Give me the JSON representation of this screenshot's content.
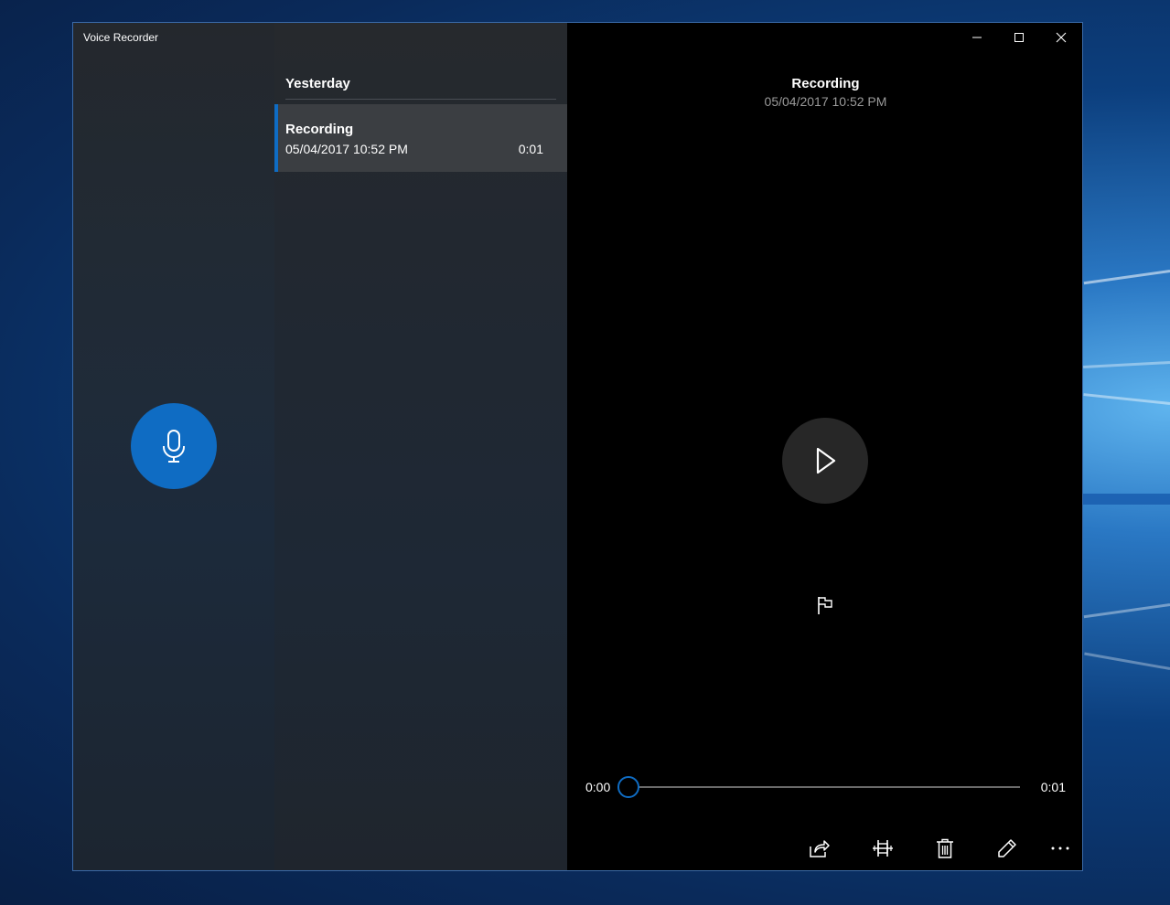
{
  "window": {
    "app_title": "Voice Recorder",
    "controls": {
      "minimize": "minimize-icon",
      "maximize": "maximize-icon",
      "close": "close-icon"
    }
  },
  "colors": {
    "accent": "#0f6cc3",
    "selected_item": "#3b3e42",
    "detail_bg": "#000000"
  },
  "record": {
    "icon": "microphone-icon"
  },
  "list": {
    "group_header": "Yesterday",
    "items": [
      {
        "name": "Recording",
        "date": "05/04/2017 10:52 PM",
        "duration": "0:01",
        "selected": true
      }
    ]
  },
  "detail": {
    "title": "Recording",
    "date": "05/04/2017 10:52 PM",
    "play_icon": "play-icon",
    "flag_icon": "flag-icon",
    "position_label": "0:00",
    "length_label": "0:01",
    "progress": 0.0
  },
  "toolbar": {
    "items": [
      "share-icon",
      "trim-icon",
      "delete-icon",
      "rename-icon",
      "more-icon"
    ]
  }
}
